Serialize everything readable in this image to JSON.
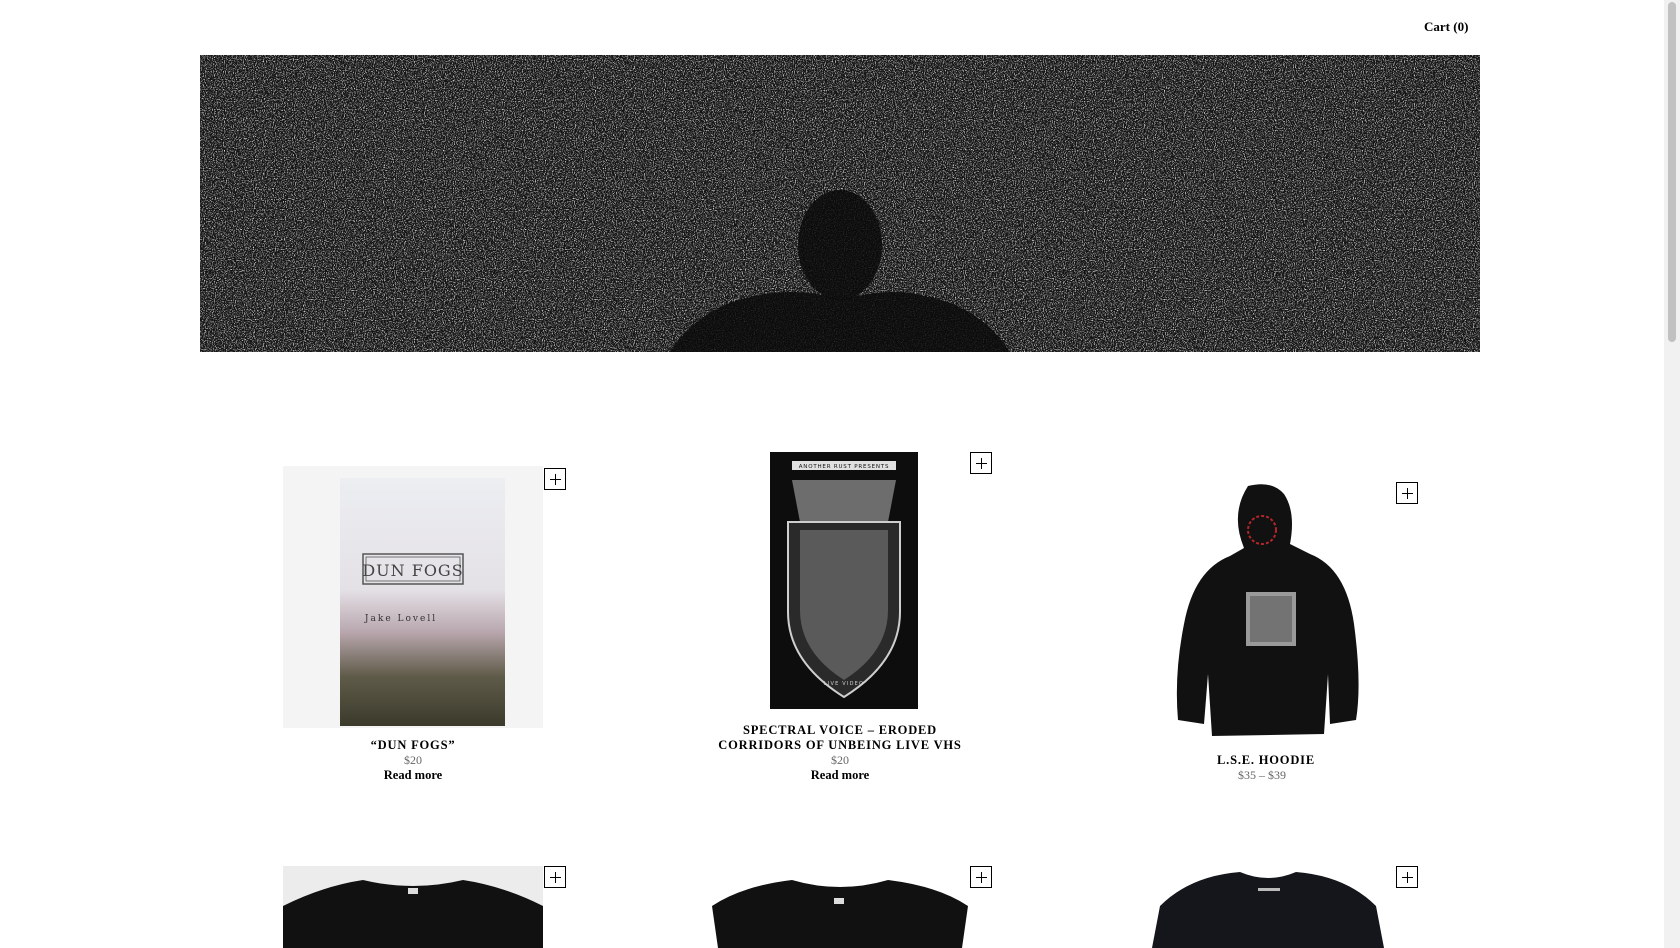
{
  "header": {
    "cart_label": "Cart (0)"
  },
  "products": [
    {
      "title": "“DUN FOGS”",
      "price": "$20",
      "action": "Read more",
      "cover_title": "DUN FOGS",
      "cover_author": "Jake Lovell"
    },
    {
      "title": "SPECTRAL VOICE – ERODED CORRIDORS OF UNBEING LIVE VHS",
      "price": "$20",
      "action": "Read more",
      "cover_top": "ANOTHER RUST PRESENTS",
      "cover_bottom": "LIVE VIDEO"
    },
    {
      "title": "L.S.E. HOODIE",
      "price": "$35 – $39"
    },
    {
      "title": ""
    },
    {
      "title": ""
    },
    {
      "title": ""
    }
  ],
  "colors": {
    "accent_red": "#b3262a",
    "text": "#000000",
    "price": "#666666"
  },
  "icons": {
    "add": "plus-icon"
  }
}
